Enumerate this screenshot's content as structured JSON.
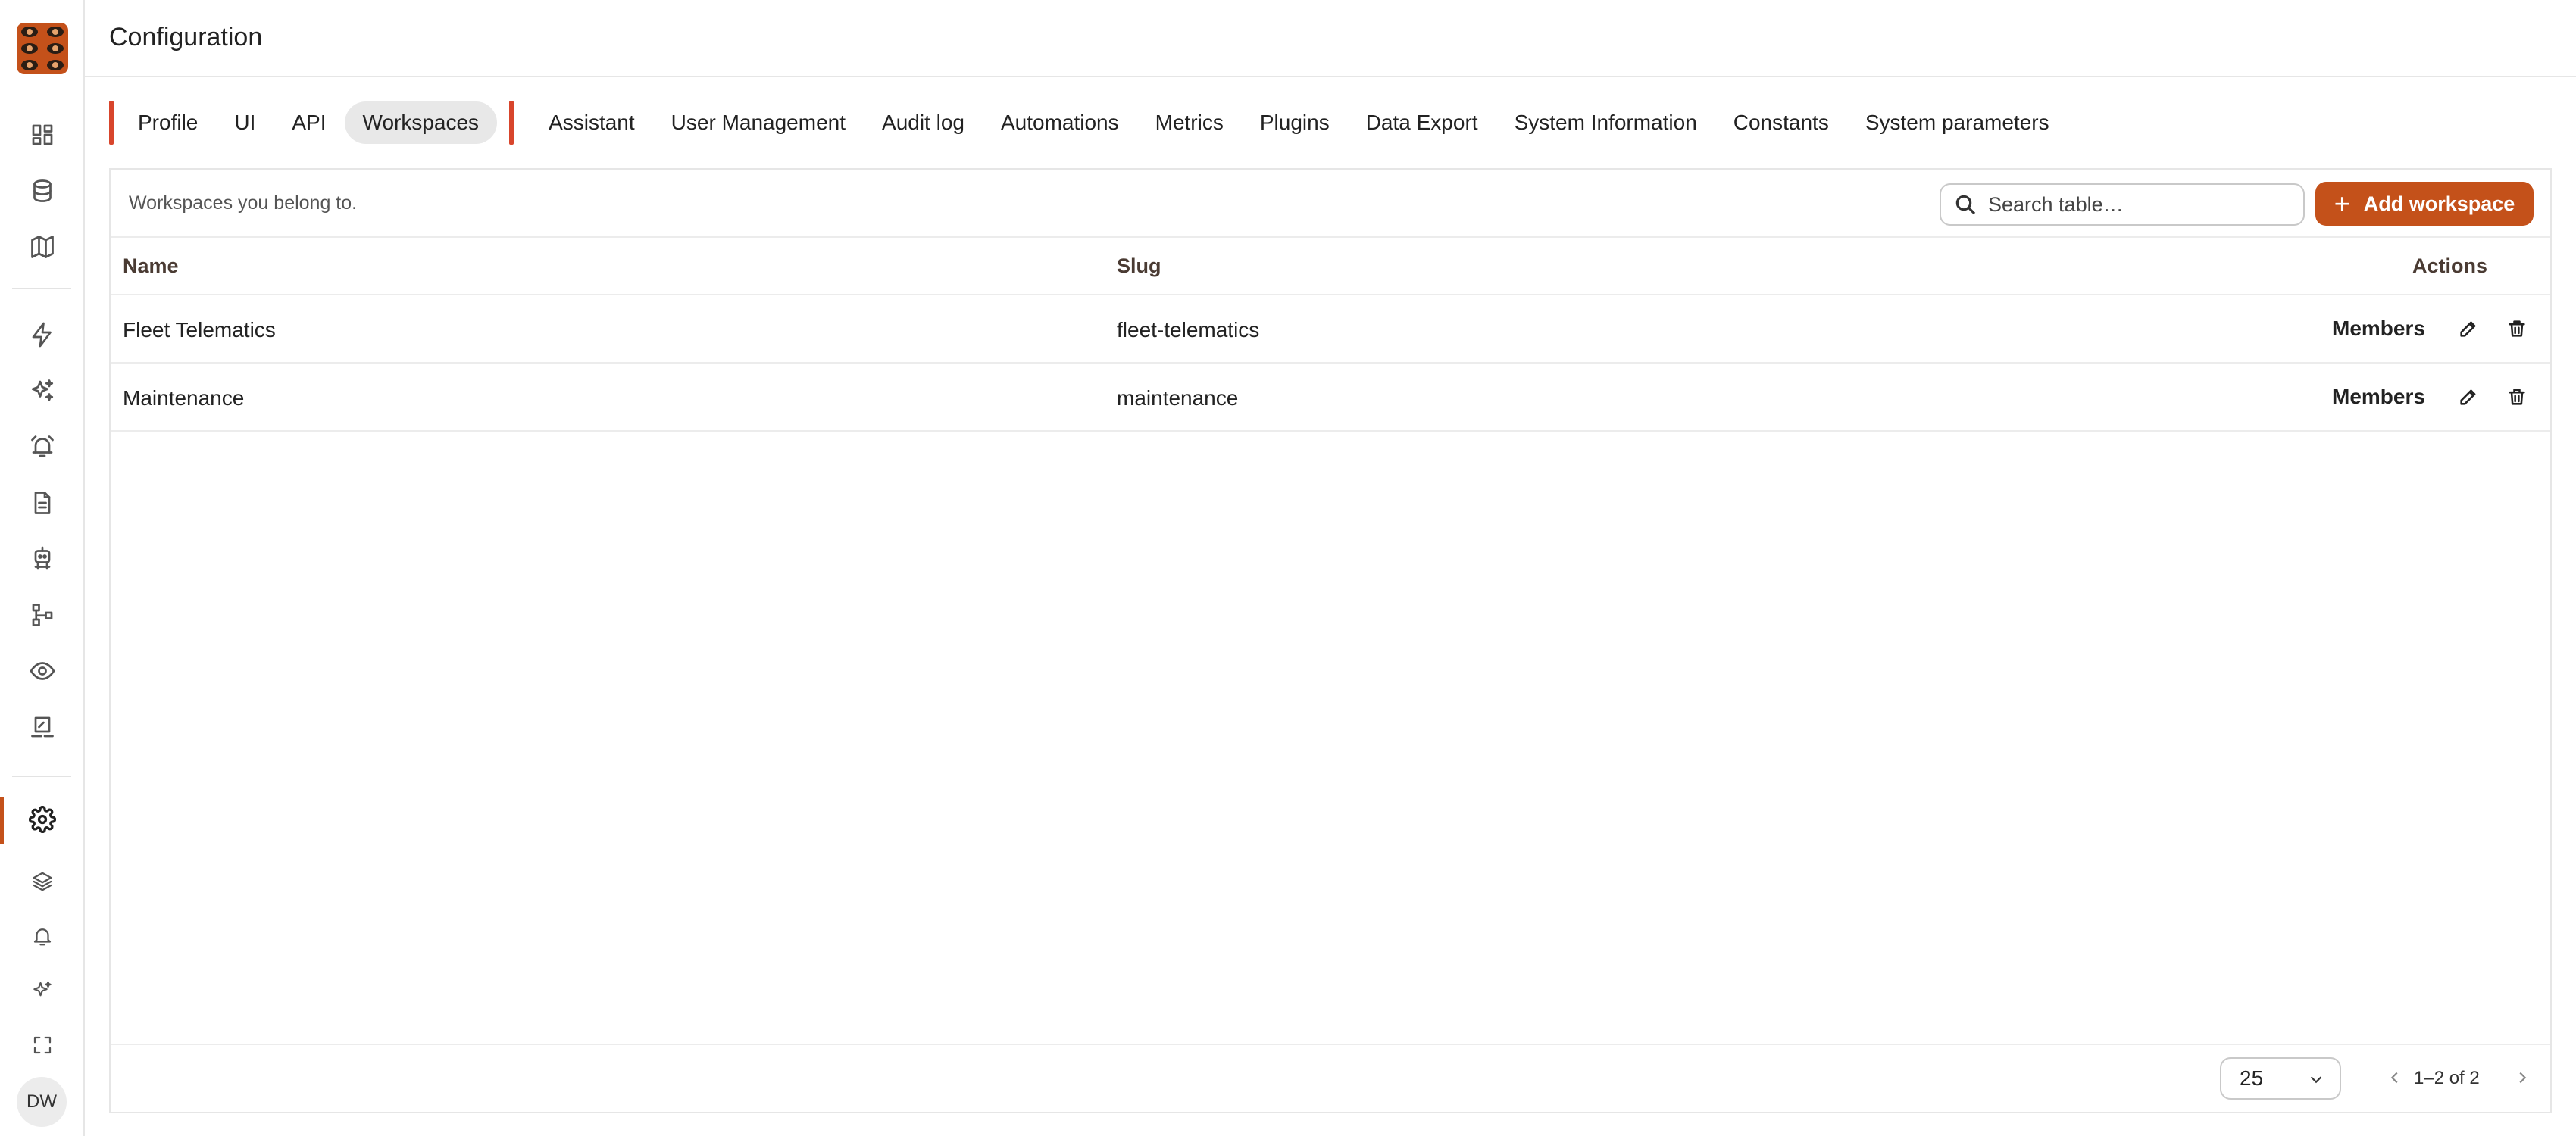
{
  "header": {
    "title": "Configuration"
  },
  "sidebar": {
    "avatar_initials": "DW",
    "icons": [
      "dashboard-icon",
      "database-icon",
      "map-icon",
      "lightning-icon",
      "sparkles-icon",
      "alarm-icon",
      "document-icon",
      "robot-icon",
      "workflow-icon",
      "eye-icon",
      "signature-icon",
      "gear-icon",
      "layers-icon",
      "bell-icon",
      "sparkles-small-icon",
      "fullscreen-icon"
    ],
    "active": "gear-icon",
    "accent_color": "#c4511a"
  },
  "tabs": [
    {
      "label": "Profile"
    },
    {
      "label": "UI"
    },
    {
      "label": "API"
    },
    {
      "label": "Workspaces",
      "active": true
    },
    {
      "label": "Assistant"
    },
    {
      "label": "User Management"
    },
    {
      "label": "Audit log"
    },
    {
      "label": "Automations"
    },
    {
      "label": "Metrics"
    },
    {
      "label": "Plugins"
    },
    {
      "label": "Data Export"
    },
    {
      "label": "System Information"
    },
    {
      "label": "Constants"
    },
    {
      "label": "System parameters"
    }
  ],
  "panel": {
    "caption": "Workspaces you belong to.",
    "search_placeholder": "Search table…",
    "add_button_label": "Add workspace",
    "columns": {
      "name": "Name",
      "slug": "Slug",
      "actions": "Actions"
    },
    "rows": [
      {
        "name": "Fleet Telematics",
        "slug": "fleet-telematics",
        "members_label": "Members"
      },
      {
        "name": "Maintenance",
        "slug": "maintenance",
        "members_label": "Members"
      }
    ],
    "footer": {
      "page_size": "25",
      "range_text": "1–2 of 2"
    }
  },
  "colors": {
    "primary": "#c4511a",
    "tab_marker": "#d8452c",
    "active_tab_bg": "#e8e8e8"
  }
}
